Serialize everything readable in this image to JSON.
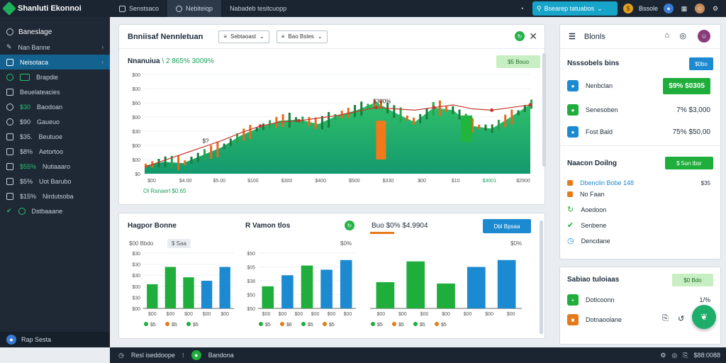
{
  "app": {
    "title": "Shanluti Ekonnoi"
  },
  "topbar": {
    "tabs": [
      {
        "label": "Senstsaco",
        "icon": "grid-icon"
      },
      {
        "label": "Nebiteiqp",
        "icon": "search-icon"
      },
      {
        "label": "Nabadeb tesitcuopp",
        "icon": ""
      }
    ],
    "search_label": "Bsearep tatuabos",
    "user_label": "Bssole"
  },
  "sidebar": {
    "header": "Baneslage",
    "items": [
      {
        "label": "Nan Banne",
        "icon": "pen-icon",
        "chev": "›"
      },
      {
        "label": "Neisotaca",
        "icon": "card-icon",
        "chev": "‹",
        "active": true
      },
      {
        "label": "Brapdie",
        "icon": "refresh-icon"
      },
      {
        "label": "Beuelateacies",
        "icon": "grid-icon"
      },
      {
        "label": "Baodoan",
        "prefix": "$30",
        "icon": "coin-icon"
      },
      {
        "label": "Gaueuo",
        "prefix": "$90",
        "icon": "coin-icon"
      },
      {
        "label": "Beutuoe",
        "prefix": "$35.",
        "icon": "doc-icon"
      },
      {
        "label": "Aetortoo",
        "prefix": "$8%",
        "icon": "doc-icon"
      },
      {
        "label": "Nutiaaaro",
        "prefix": "$55%",
        "icon": "card-icon"
      },
      {
        "label": "Uot Barubo",
        "prefix": "$5%",
        "icon": "card-icon"
      },
      {
        "label": "Nirdutsoba",
        "prefix": "$15%",
        "icon": "card-icon"
      },
      {
        "label": "Dstbaaane",
        "icon": "check-icon"
      }
    ],
    "footer": "Rap Sesta"
  },
  "main_panel": {
    "title": "Bnniisaf Nennletuan",
    "dropdown1": "Sebtaoast",
    "dropdown2": "Bao Bstes",
    "chart_title": "Nnanuiua",
    "chart_title_pct": "\\ 2 865% 3009%",
    "badge": "$5 Bouo",
    "legend": "Ol Ranaerl $0.65",
    "annot_1": "$?",
    "annot_2": "$300%"
  },
  "bottom_panel": {
    "col1_title": "Hagpor Bonne",
    "col2_title": "R Vamon tlos",
    "col3_title": "Buo $0% $4.9904",
    "pill": "Dbl Bpsaa",
    "col1_filter": "$00 Bbdo",
    "col1_chip": "$ Saa",
    "col2_pct": "$0%",
    "col3_pct": "$0%"
  },
  "right_panel": {
    "title": "Blonls",
    "section1_title": "Nsssobels bins",
    "section1_pill": "$0bo",
    "rows": [
      {
        "label": "Nenbclan",
        "value": "$9% $0305",
        "boxed": true,
        "color": "#1b8ad0"
      },
      {
        "label": "Senesoben",
        "value": "7% $3,000",
        "color": "#1fae3b"
      },
      {
        "label": "Fost Bald",
        "value": "75% $50,00",
        "color": "#1b8ad0"
      }
    ],
    "section2_title": "Naacon Doilng",
    "section2_pill": "$ 5un tbsr",
    "list": [
      {
        "label": "Dbenclin Bobe 148",
        "value": "$35",
        "color": "#e67a1a"
      },
      {
        "label": "No Faan",
        "value": "",
        "color": "#e67a1a"
      },
      {
        "label": "Aoedoon",
        "value": "",
        "color": "#1fae3b"
      },
      {
        "label": "Senbene",
        "value": "",
        "color": "#1fae3b"
      },
      {
        "label": "Dencdane",
        "value": "",
        "color": "#1b8ad0"
      }
    ]
  },
  "right_panel2": {
    "title": "Sabiao tuloiaas",
    "pill": "$0 Bdo",
    "rows": [
      {
        "label": "Dotlcoonn",
        "value": "1/%",
        "color": "#1fae3b"
      },
      {
        "label": "Dotnaoolane",
        "value": "",
        "color": "#e67a1a"
      }
    ]
  },
  "bottombar": {
    "left": "Resl iseddoope",
    "mid": "Bandona",
    "right": "$88:0088"
  },
  "chart_data": [
    {
      "type": "area",
      "series": [
        {
          "values": [
            12,
            18,
            16,
            28,
            40,
            58,
            70,
            80,
            82,
            75,
            88,
            96,
            108,
            92,
            78,
            100,
            96,
            72,
            68,
            86,
            105
          ]
        }
      ],
      "x": [
        "$00",
        "$4.00",
        "$5.00",
        "$100",
        "$300",
        "$400",
        "$500",
        "$330",
        "$00",
        "$10",
        "$3001",
        "$2900"
      ],
      "y_ticks": [
        "$00",
        "$00",
        "$60",
        "$00",
        "$30",
        "$00",
        "$00",
        "$0"
      ],
      "ylim": [
        0,
        150
      ]
    },
    {
      "type": "bar",
      "values": [
        35,
        60,
        45,
        40,
        60
      ],
      "colors": [
        "#1fae3b",
        "#1fae3b",
        "#1fae3b",
        "#1b8ad0",
        "#1b8ad0"
      ],
      "categories": [
        "$00",
        "$00",
        "$00",
        "$00",
        "$00"
      ],
      "y_ticks": [
        "$30",
        "$30",
        "$30",
        "$00",
        "$30",
        "$00"
      ],
      "legend": [
        "$5",
        "$5",
        "$5"
      ]
    },
    {
      "type": "bar",
      "values": [
        32,
        48,
        62,
        56,
        70
      ],
      "colors": [
        "#1fae3b",
        "#1b8ad0",
        "#1fae3b",
        "#1b8ad0",
        "#1b8ad0"
      ],
      "categories": [
        "$00",
        "$00",
        "$00",
        "$00",
        "$00",
        "$00"
      ],
      "y_ticks": [
        "$50",
        "$05",
        "$38",
        "$50",
        "$50"
      ],
      "legend": [
        "$5",
        "$6",
        "$5",
        "$5"
      ]
    },
    {
      "type": "bar",
      "values": [
        38,
        68,
        36,
        60,
        70
      ],
      "colors": [
        "#1fae3b",
        "#1fae3b",
        "#1fae3b",
        "#1b8ad0",
        "#1b8ad0"
      ],
      "categories": [
        "$00",
        "$00",
        "$00",
        "$00",
        "$00",
        "$00",
        "$00"
      ],
      "legend": [
        "$5",
        "$5",
        "$5",
        "$5"
      ]
    }
  ]
}
